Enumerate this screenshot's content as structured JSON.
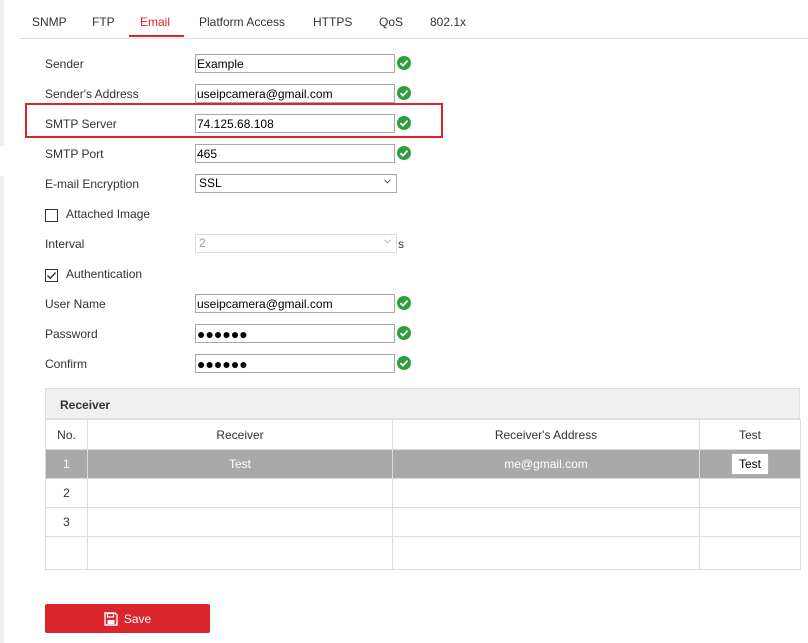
{
  "tabs": [
    {
      "label": "SNMP"
    },
    {
      "label": "FTP"
    },
    {
      "label": "Email",
      "active": true
    },
    {
      "label": "Platform Access"
    },
    {
      "label": "HTTPS"
    },
    {
      "label": "QoS"
    },
    {
      "label": "802.1x"
    }
  ],
  "form": {
    "sender": {
      "label": "Sender",
      "value": "Example"
    },
    "sender_address": {
      "label": "Sender's Address",
      "value": "useipcamera@gmail.com"
    },
    "smtp_server": {
      "label": "SMTP Server",
      "value": "74.125.68.108"
    },
    "smtp_port": {
      "label": "SMTP Port",
      "value": "465"
    },
    "encryption": {
      "label": "E-mail Encryption",
      "value": "SSL"
    },
    "attached_image": {
      "label": "Attached Image",
      "checked": false
    },
    "interval": {
      "label": "Interval",
      "value": "2",
      "unit": "s"
    },
    "authentication": {
      "label": "Authentication",
      "checked": true
    },
    "user_name": {
      "label": "User Name",
      "value": "useipcamera@gmail.com"
    },
    "password": {
      "label": "Password",
      "value": "●●●●●●"
    },
    "confirm": {
      "label": "Confirm",
      "value": "●●●●●●"
    }
  },
  "receiver": {
    "title": "Receiver",
    "columns": [
      "No.",
      "Receiver",
      "Receiver's Address",
      "Test"
    ],
    "rows": [
      {
        "no": "1",
        "receiver": "Test",
        "address": "me@gmail.com",
        "test_label": "Test"
      },
      {
        "no": "2",
        "receiver": "",
        "address": ""
      },
      {
        "no": "3",
        "receiver": "",
        "address": ""
      },
      {
        "no": "",
        "receiver": "",
        "address": ""
      }
    ]
  },
  "save_label": "Save",
  "colors": {
    "accent": "#d9252b",
    "ok": "#2e9f3e",
    "selected_row": "#a9a9a9"
  },
  "icons": {
    "valid": "check-circle-icon",
    "save": "floppy-disk-icon",
    "dropdown": "chevron-down-icon"
  }
}
